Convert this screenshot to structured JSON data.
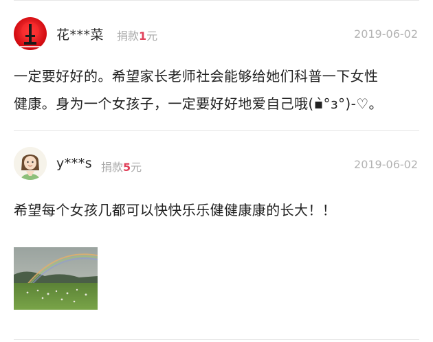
{
  "comments": [
    {
      "user_name": "花***菜",
      "donation_prefix": "捐款",
      "donation_amount": "1",
      "donation_suffix": "元",
      "date": "2019-06-02",
      "text_line1": "一定要好好的。希望家长老师社会能够给她们科普一下女性",
      "text_line2": "健康。身为一个女孩子，一定要好好地爱自己哦(▪̀°з°)-♡。"
    },
    {
      "user_name": "y***s",
      "donation_prefix": "捐款",
      "donation_amount": "5",
      "donation_suffix": "元",
      "date": "2019-06-02",
      "text_line1": "希望每个女孩几都可以快快乐乐健健康康的长大！！"
    }
  ],
  "colors": {
    "donation_amount": "#e0415a",
    "meta_gray": "#b3b3b3",
    "avatar_red": "#d80f14"
  },
  "icons": {
    "avatar1": "red-tower-avatar",
    "avatar2": "cartoon-girl-avatar",
    "photo": "rainbow-meadow-photo"
  }
}
